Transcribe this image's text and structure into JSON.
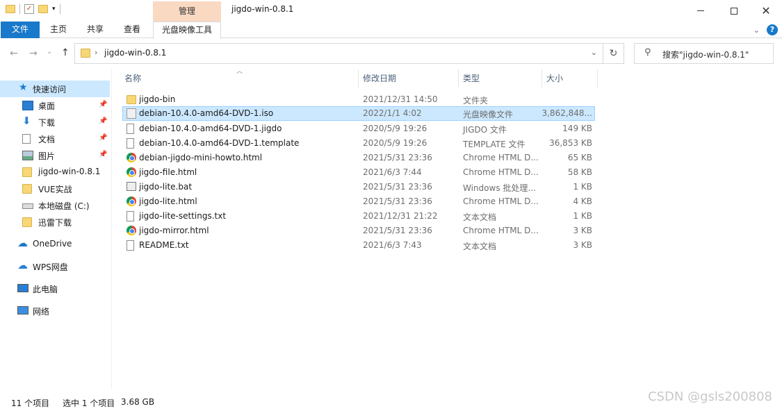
{
  "window": {
    "title": "jigdo-win-0.8.1",
    "contextual_tab_group": "管理"
  },
  "ribbon": {
    "tabs": [
      "文件",
      "主页",
      "共享",
      "查看",
      "光盘映像工具"
    ]
  },
  "address": {
    "path": "jigdo-win-0.8.1",
    "search_placeholder": "搜索\"jigdo-win-0.8.1\""
  },
  "nav": {
    "items": [
      {
        "label": "快速访问",
        "icon": "star-icon",
        "pinned": false
      },
      {
        "label": "桌面",
        "icon": "desktop-icon",
        "pinned": true
      },
      {
        "label": "下载",
        "icon": "download-icon",
        "pinned": true
      },
      {
        "label": "文档",
        "icon": "document-icon",
        "pinned": true
      },
      {
        "label": "图片",
        "icon": "picture-icon",
        "pinned": true
      },
      {
        "label": "jigdo-win-0.8.1",
        "icon": "folder-icon",
        "pinned": false
      },
      {
        "label": "VUE实战",
        "icon": "folder-icon",
        "pinned": false
      },
      {
        "label": "本地磁盘 (C:)",
        "icon": "drive-icon",
        "pinned": false
      },
      {
        "label": "迅雷下载",
        "icon": "folder-icon",
        "pinned": false
      },
      {
        "label": "OneDrive",
        "icon": "cloud-icon",
        "pinned": false
      },
      {
        "label": "WPS网盘",
        "icon": "wps-cloud-icon",
        "pinned": false
      },
      {
        "label": "此电脑",
        "icon": "computer-icon",
        "pinned": false
      },
      {
        "label": "网络",
        "icon": "network-icon",
        "pinned": false
      }
    ]
  },
  "columns": {
    "name": "名称",
    "date": "修改日期",
    "type": "类型",
    "size": "大小"
  },
  "files": [
    {
      "name": "jigdo-bin",
      "date": "2021/12/31 14:50",
      "type": "文件夹",
      "size": "",
      "icon": "folder-icon"
    },
    {
      "name": "debian-10.4.0-amd64-DVD-1.iso",
      "date": "2022/1/1 4:02",
      "type": "光盘映像文件",
      "size": "3,862,848...",
      "icon": "disc-image-icon"
    },
    {
      "name": "debian-10.4.0-amd64-DVD-1.jigdo",
      "date": "2020/5/9 19:26",
      "type": "JIGDO 文件",
      "size": "149 KB",
      "icon": "file-icon"
    },
    {
      "name": "debian-10.4.0-amd64-DVD-1.template",
      "date": "2020/5/9 19:26",
      "type": "TEMPLATE 文件",
      "size": "36,853 KB",
      "icon": "file-icon"
    },
    {
      "name": "debian-jigdo-mini-howto.html",
      "date": "2021/5/31 23:36",
      "type": "Chrome HTML D...",
      "size": "65 KB",
      "icon": "chrome-icon"
    },
    {
      "name": "jigdo-file.html",
      "date": "2021/6/3 7:44",
      "type": "Chrome HTML D...",
      "size": "58 KB",
      "icon": "chrome-icon"
    },
    {
      "name": "jigdo-lite.bat",
      "date": "2021/5/31 23:36",
      "type": "Windows 批处理...",
      "size": "1 KB",
      "icon": "batch-file-icon"
    },
    {
      "name": "jigdo-lite.html",
      "date": "2021/5/31 23:36",
      "type": "Chrome HTML D...",
      "size": "4 KB",
      "icon": "chrome-icon"
    },
    {
      "name": "jigdo-lite-settings.txt",
      "date": "2021/12/31 21:22",
      "type": "文本文档",
      "size": "1 KB",
      "icon": "text-file-icon"
    },
    {
      "name": "jigdo-mirror.html",
      "date": "2021/5/31 23:36",
      "type": "Chrome HTML D...",
      "size": "3 KB",
      "icon": "chrome-icon"
    },
    {
      "name": "README.txt",
      "date": "2021/6/3 7:43",
      "type": "文本文档",
      "size": "3 KB",
      "icon": "text-file-icon"
    }
  ],
  "status": {
    "count": "11 个项目",
    "selection": "选中 1 个项目",
    "selection_size": "3.68 GB"
  },
  "watermark": "CSDN @gsls200808"
}
